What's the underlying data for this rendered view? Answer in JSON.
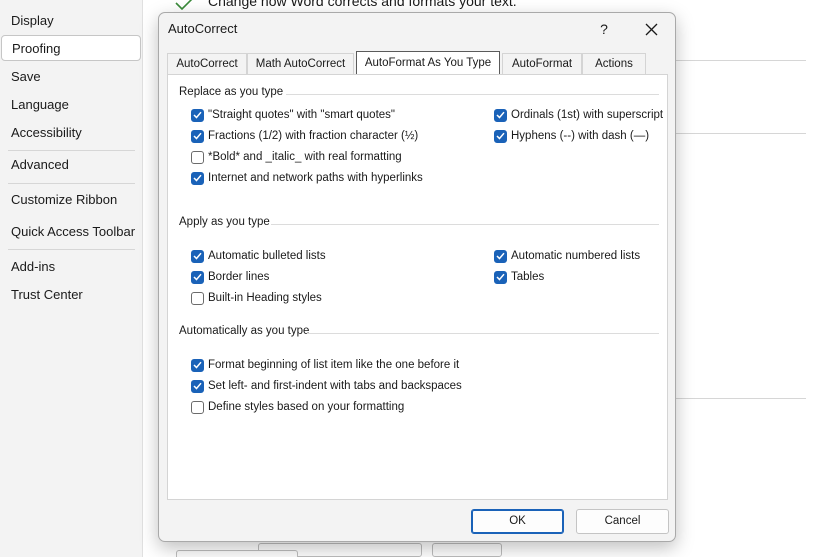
{
  "sidebar": {
    "items": [
      {
        "label": "Display",
        "active": false
      },
      {
        "label": "Proofing",
        "active": true
      },
      {
        "label": "Save",
        "active": false
      },
      {
        "label": "Language",
        "active": false
      },
      {
        "label": "Accessibility",
        "active": false
      },
      {
        "label": "Advanced",
        "active": false
      },
      {
        "label": "Customize Ribbon",
        "active": false
      },
      {
        "label": "Quick Access Toolbar",
        "active": false
      },
      {
        "label": "Add-ins",
        "active": false
      },
      {
        "label": "Trust Center",
        "active": false
      }
    ]
  },
  "background": {
    "header_text": "Change how Word corrects and formats your text."
  },
  "dialog": {
    "title": "AutoCorrect",
    "help_label": "?",
    "tabs": [
      {
        "label": "AutoCorrect",
        "active": false
      },
      {
        "label": "Math AutoCorrect",
        "active": false
      },
      {
        "label": "AutoFormat As You Type",
        "active": true
      },
      {
        "label": "AutoFormat",
        "active": false
      },
      {
        "label": "Actions",
        "active": false
      }
    ],
    "groups": {
      "replace": {
        "title": "Replace as you type",
        "options": [
          {
            "label": "\"Straight quotes\" with \"smart quotes\"",
            "checked": true
          },
          {
            "label": "Fractions (1/2) with fraction character (½)",
            "checked": true
          },
          {
            "label": "*Bold* and _italic_ with real formatting",
            "checked": false
          },
          {
            "label": "Internet and network paths with hyperlinks",
            "checked": true
          },
          {
            "label": "Ordinals (1st) with superscript",
            "checked": true
          },
          {
            "label": "Hyphens (--) with dash (—)",
            "checked": true
          }
        ]
      },
      "apply": {
        "title": "Apply as you type",
        "options": [
          {
            "label": "Automatic bulleted lists",
            "checked": true
          },
          {
            "label": "Border lines",
            "checked": true
          },
          {
            "label": "Built-in Heading styles",
            "checked": false
          },
          {
            "label": "Automatic numbered lists",
            "checked": true
          },
          {
            "label": "Tables",
            "checked": true
          }
        ]
      },
      "auto": {
        "title": "Automatically as you type",
        "options": [
          {
            "label": "Format beginning of list item like the one before it",
            "checked": true
          },
          {
            "label": "Set left- and first-indent with tabs and backspaces",
            "checked": true
          },
          {
            "label": "Define styles based on your formatting",
            "checked": false
          }
        ]
      }
    },
    "ok_label": "OK",
    "cancel_label": "Cancel"
  },
  "colors": {
    "accent": "#1a62b8",
    "dialog_bg": "#f3f3f3",
    "sidebar_bg": "#f3f3f3"
  }
}
